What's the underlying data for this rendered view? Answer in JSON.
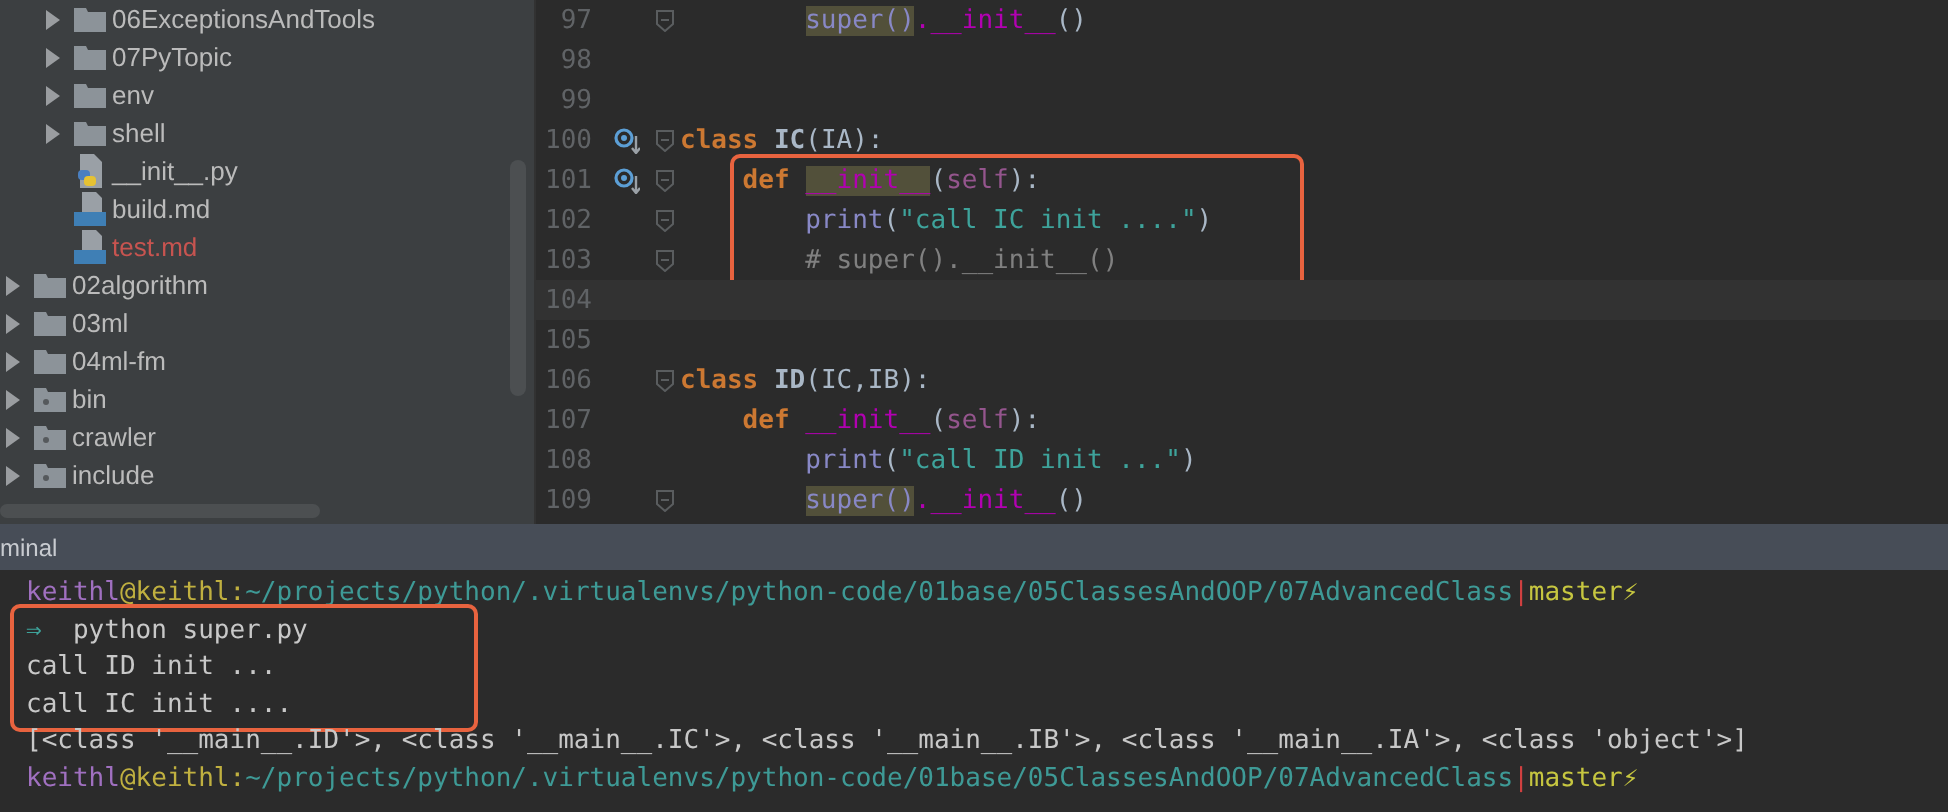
{
  "project_tree": [
    {
      "children": [
        {
          "label": "06ExceptionsAndTools",
          "kind": "folder",
          "expanded": false,
          "color": "#bbbbbb"
        },
        {
          "label": "07PyTopic",
          "kind": "folder",
          "expanded": false,
          "color": "#bbbbbb"
        },
        {
          "label": "env",
          "kind": "folder",
          "expanded": false,
          "color": "#bbbbbb"
        },
        {
          "label": "shell",
          "kind": "folder",
          "expanded": false,
          "color": "#bbbbbb"
        },
        {
          "label": "__init__.py",
          "kind": "python",
          "color": "#bbbbbb"
        },
        {
          "label": "build.md",
          "kind": "markdown",
          "color": "#bbbbbb"
        },
        {
          "label": "test.md",
          "kind": "markdown",
          "color": "#c75450"
        }
      ]
    },
    {
      "label": "02algorithm",
      "kind": "folder",
      "expanded": false,
      "color": "#bbbbbb"
    },
    {
      "label": "03ml",
      "kind": "folder",
      "expanded": false,
      "color": "#bbbbbb"
    },
    {
      "label": "04ml-fm",
      "kind": "folder",
      "expanded": false,
      "color": "#bbbbbb"
    },
    {
      "label": "bin",
      "kind": "excluded-folder",
      "expanded": false,
      "color": "#bbbbbb"
    },
    {
      "label": "crawler",
      "kind": "excluded-folder",
      "expanded": false,
      "color": "#bbbbbb"
    },
    {
      "label": "include",
      "kind": "excluded-folder",
      "expanded": false,
      "color": "#bbbbbb"
    }
  ],
  "editor": {
    "lines": [
      {
        "children": [
          {
            "children": [
              {
                "number": "97",
                "fold": true,
                "tokens": [
                  {
                    "kind": "builtin",
                    "text": "super()",
                    "marked": true
                  },
                  {
                    "kind": "dunder",
                    "text": ".__init__"
                  },
                  {
                    "kind": "plain",
                    "text": "()"
                  }
                ]
              }
            ]
          }
        ]
      },
      {
        "number": "98"
      },
      {
        "number": "99"
      },
      {
        "number": "100",
        "override": true,
        "fold": true,
        "tokens": [
          {
            "kind": "keyword",
            "text": "class "
          },
          {
            "kind": "classname",
            "text": "IC"
          },
          {
            "kind": "plain",
            "text": "(IA):"
          }
        ],
        "children": [
          {
            "number": "101",
            "override": true,
            "fold": true,
            "boxed": true,
            "tokens": [
              {
                "kind": "keyword",
                "text": "def "
              },
              {
                "kind": "dunder",
                "text": "__init__",
                "marked": true
              },
              {
                "kind": "plain",
                "text": "("
              },
              {
                "kind": "self",
                "text": "self"
              },
              {
                "kind": "plain",
                "text": "):"
              }
            ],
            "children": [
              {
                "number": "102",
                "fold": true,
                "tokens": [
                  {
                    "kind": "builtin",
                    "text": "print"
                  },
                  {
                    "kind": "plain",
                    "text": "("
                  },
                  {
                    "kind": "string",
                    "text": "\"call IC init ....\""
                  },
                  {
                    "kind": "plain",
                    "text": ")"
                  }
                ]
              },
              {
                "number": "103",
                "fold": true,
                "tokens": [
                  {
                    "kind": "comment",
                    "text": "# super().__init__()"
                  }
                ]
              }
            ]
          }
        ]
      },
      {
        "number": "104",
        "current": true
      },
      {
        "number": "105"
      },
      {
        "number": "106",
        "fold": true,
        "tokens": [
          {
            "kind": "keyword",
            "text": "class "
          },
          {
            "kind": "classname",
            "text": "ID"
          },
          {
            "kind": "plain",
            "text": "(IC,IB):"
          }
        ],
        "children": [
          {
            "number": "107",
            "tokens": [
              {
                "kind": "keyword",
                "text": "def "
              },
              {
                "kind": "dunder",
                "text": "__init__"
              },
              {
                "kind": "plain",
                "text": "("
              },
              {
                "kind": "self",
                "text": "self"
              },
              {
                "kind": "plain",
                "text": "):"
              }
            ],
            "children": [
              {
                "number": "108",
                "tokens": [
                  {
                    "kind": "builtin",
                    "text": "print"
                  },
                  {
                    "kind": "plain",
                    "text": "("
                  },
                  {
                    "kind": "string",
                    "text": "\"call ID init ...\""
                  },
                  {
                    "kind": "plain",
                    "text": ")"
                  }
                ]
              },
              {
                "number": "109",
                "fold": true,
                "tokens": [
                  {
                    "kind": "builtin",
                    "text": "super()",
                    "marked": true
                  },
                  {
                    "kind": "dunder",
                    "text": ".__init__"
                  },
                  {
                    "kind": "plain",
                    "text": "()"
                  }
                ]
              }
            ]
          }
        ]
      }
    ]
  },
  "terminal": {
    "title": "minal",
    "lines": [
      {
        "tokens": [
          {
            "kind": "user",
            "text": "keithl"
          },
          {
            "kind": "host",
            "text": "@keithl:"
          },
          {
            "kind": "path",
            "text": "~/projects/python/.virtualenvs/python-code/01base/05ClassesAndOOP/07AdvancedClass"
          },
          {
            "kind": "sep",
            "text": "|"
          },
          {
            "kind": "branch",
            "text": "master⚡"
          }
        ]
      },
      {
        "boxed": true,
        "tokens": [
          {
            "kind": "arrow",
            "text": "⇒"
          },
          {
            "kind": "out",
            "text": "python super.py"
          }
        ]
      },
      {
        "boxed": true,
        "tokens": [
          {
            "kind": "out",
            "text": "call ID init ..."
          }
        ]
      },
      {
        "boxed": true,
        "tokens": [
          {
            "kind": "out",
            "text": "call IC init ...."
          }
        ]
      },
      {
        "tokens": [
          {
            "kind": "out",
            "text": "[<class '__main__.ID'>, <class '__main__.IC'>, <class '__main__.IB'>, <class '__main__.IA'>, <class 'object'>]"
          }
        ]
      },
      {
        "tokens": [
          {
            "kind": "user",
            "text": "keithl"
          },
          {
            "kind": "host",
            "text": "@keithl:"
          },
          {
            "kind": "path",
            "text": "~/projects/python/.virtualenvs/python-code/01base/05ClassesAndOOP/07AdvancedClass"
          },
          {
            "kind": "sep",
            "text": "|"
          },
          {
            "kind": "branch",
            "text": "master⚡"
          }
        ]
      }
    ]
  }
}
